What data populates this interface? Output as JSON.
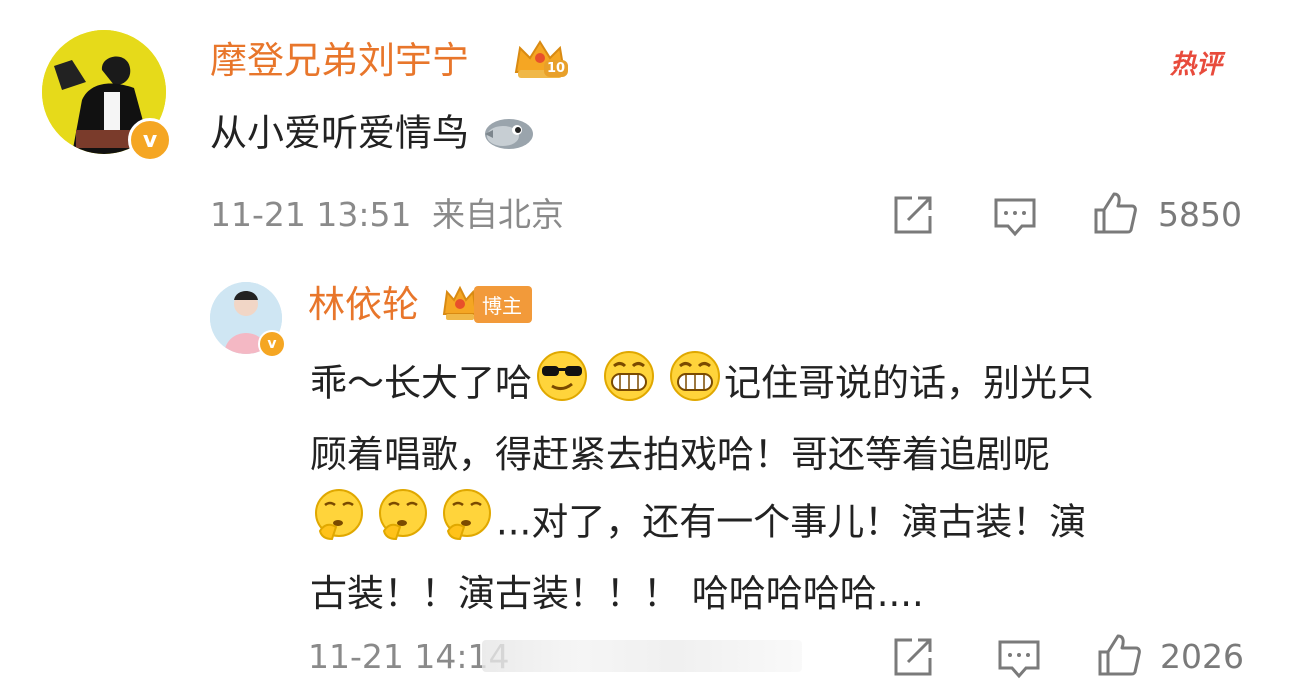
{
  "comment": {
    "username": "摩登兄弟刘宇宁",
    "text": "从小爱听爱情鸟",
    "timestamp": "11-21 13:51",
    "location": "来自北京",
    "like_count": "5850",
    "hot_label": "热评",
    "rank_badge": "10"
  },
  "reply": {
    "username": "林依轮",
    "badge_label": "博主",
    "text_lines": [
      "乖～长大了哈",
      "记住哥说的话，别光只",
      "顾着唱歌，得赶紧去拍戏哈！哥还等着追剧呢",
      "...对了，还有一个事儿！演古装！演",
      "古装！！演古装！！！ 哈哈哈哈哈...."
    ],
    "timestamp": "11-21 14:14",
    "like_count": "2026"
  },
  "colors": {
    "username": "#e8762b",
    "hot": "#e84b3c",
    "verified": "#f5a623"
  },
  "icons": [
    "share-icon",
    "comment-icon",
    "like-icon",
    "bird-emoji",
    "cool-emoji",
    "grin-emoji",
    "thinking-emoji",
    "crown-icon"
  ]
}
